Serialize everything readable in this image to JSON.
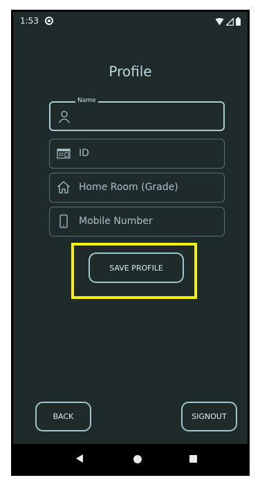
{
  "status_bar": {
    "time": "1:53"
  },
  "page": {
    "title": "Profile"
  },
  "fields": {
    "name": {
      "label": "Name",
      "value": ""
    },
    "id": {
      "placeholder": "ID"
    },
    "home_room": {
      "placeholder": "Home Room (Grade)"
    },
    "mobile": {
      "placeholder": "Mobile Number"
    }
  },
  "buttons": {
    "save_profile": "SAVE PROFILE",
    "back": "BACK",
    "signout": "SIGNOUT"
  },
  "colors": {
    "background": "#1f2b2b",
    "accent": "#a9cdd0",
    "highlight": "#f6f00b"
  },
  "icons": {
    "status_app": "target-icon",
    "wifi": "wifi-icon",
    "signal": "signal-icon",
    "battery": "battery-icon",
    "name": "person-icon",
    "id": "id-card-icon",
    "home_room": "house-icon",
    "mobile": "phone-icon"
  }
}
